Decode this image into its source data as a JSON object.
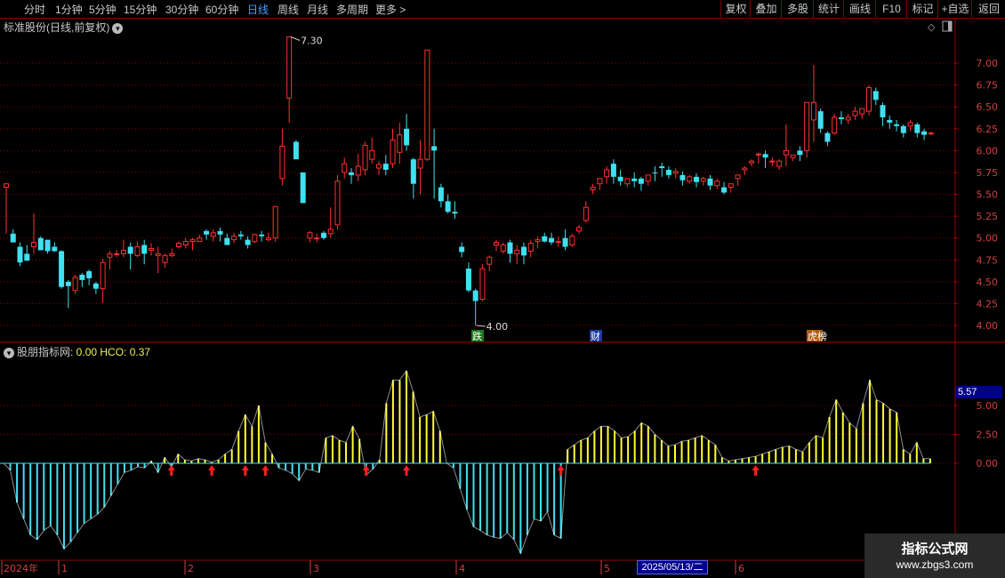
{
  "toolbar": {
    "periods": [
      "分时",
      "1分钟",
      "5分钟",
      "15分钟",
      "30分钟",
      "60分钟",
      "日线",
      "周线",
      "月线",
      "多周期",
      "更多 >"
    ],
    "right": [
      "复权",
      "叠加",
      "多股",
      "统计",
      "画线",
      "F10",
      "标记",
      "+自选",
      "返回"
    ]
  },
  "price_panel": {
    "title": "标准股份(日线,前复权)",
    "high_label": "7.30",
    "low_label": "4.00",
    "y_ticks": [
      "7.00",
      "6.75",
      "6.50",
      "6.25",
      "6.00",
      "5.75",
      "5.50",
      "5.25",
      "5.00",
      "4.75",
      "4.50",
      "4.25",
      "4.00"
    ],
    "badges": [
      {
        "text": "跌",
        "color": "#1a7a1a"
      },
      {
        "text": "财",
        "color": "#1a3aa0"
      },
      {
        "text": "龙虎榜",
        "color": "#b05a10"
      }
    ]
  },
  "indicator_panel": {
    "title": "股朋指标网",
    "value_label": ": 0.00",
    "hco_label": "HCO: 0.37",
    "y_ticks": [
      "5.00",
      "2.50",
      "0.00"
    ],
    "cursor_value": "5.57"
  },
  "date_axis": {
    "year_label": "2024年",
    "months": [
      "1",
      "2",
      "3",
      "4",
      "5",
      "6"
    ],
    "cursor_date": "2025/05/13/二"
  },
  "watermark": {
    "line1": "指标公式网",
    "line2": "www.zbgs3.com"
  },
  "colors": {
    "up": "#ff3030",
    "down": "#40e0f0",
    "ind_pos": "#ffff30",
    "ind_neg": "#40e0f0",
    "grid": "#8a0000"
  },
  "chart_data": {
    "type": "candlestick",
    "ylim": [
      3.95,
      7.35
    ],
    "candles": [
      [
        5.58,
        5.62,
        5.62,
        5.05
      ],
      [
        5.05,
        5.1,
        4.95,
        4.95
      ],
      [
        4.9,
        4.95,
        4.72,
        4.68
      ],
      [
        4.82,
        4.92,
        4.74,
        4.76
      ],
      [
        4.9,
        5.28,
        4.95,
        4.82
      ],
      [
        5.0,
        5.02,
        4.86,
        4.88
      ],
      [
        4.98,
        4.98,
        4.85,
        4.82
      ],
      [
        4.9,
        4.95,
        4.85,
        4.84
      ],
      [
        4.85,
        4.86,
        4.44,
        4.42
      ],
      [
        4.5,
        4.52,
        4.45,
        4.2
      ],
      [
        4.4,
        4.58,
        4.55,
        4.36
      ],
      [
        4.58,
        4.6,
        4.52,
        4.44
      ],
      [
        4.62,
        4.64,
        4.54,
        4.46
      ],
      [
        4.48,
        4.5,
        4.42,
        4.36
      ],
      [
        4.42,
        4.76,
        4.72,
        4.26
      ],
      [
        4.78,
        4.85,
        4.82,
        4.64
      ],
      [
        4.82,
        4.86,
        4.82,
        4.78
      ],
      [
        4.82,
        4.98,
        4.86,
        4.78
      ],
      [
        4.9,
        4.95,
        4.82,
        4.64
      ],
      [
        4.8,
        4.96,
        4.9,
        4.78
      ],
      [
        4.92,
        4.98,
        4.82,
        4.7
      ],
      [
        4.86,
        4.94,
        4.88,
        4.8
      ],
      [
        4.8,
        4.9,
        4.82,
        4.6
      ],
      [
        4.72,
        4.82,
        4.8,
        4.66
      ],
      [
        4.8,
        4.88,
        4.82,
        4.78
      ],
      [
        4.9,
        4.96,
        4.94,
        4.88
      ],
      [
        4.92,
        5.0,
        4.96,
        4.88
      ],
      [
        4.96,
        5.0,
        4.98,
        4.86
      ],
      [
        4.96,
        5.04,
        5.0,
        4.96
      ],
      [
        5.08,
        5.1,
        5.04,
        4.98
      ],
      [
        5.02,
        5.1,
        5.06,
        4.96
      ],
      [
        5.08,
        5.12,
        5.04,
        4.96
      ],
      [
        5.0,
        5.05,
        4.92,
        4.92
      ],
      [
        4.98,
        5.06,
        5.02,
        4.94
      ],
      [
        5.04,
        5.08,
        5.02,
        4.98
      ],
      [
        4.98,
        5.02,
        4.92,
        4.88
      ],
      [
        4.96,
        5.05,
        5.04,
        4.94
      ],
      [
        5.04,
        5.08,
        5.02,
        4.96
      ],
      [
        4.98,
        5.06,
        5.0,
        4.96
      ],
      [
        5.0,
        5.35,
        5.36,
        4.96
      ],
      [
        5.68,
        6.25,
        6.05,
        5.6
      ],
      [
        6.6,
        7.3,
        7.3,
        6.32
      ],
      [
        6.1,
        6.12,
        5.9,
        5.9
      ],
      [
        5.75,
        5.65,
        5.4,
        5.4
      ],
      [
        5.0,
        5.08,
        5.06,
        4.95
      ],
      [
        5.0,
        5.05,
        5.0,
        4.95
      ],
      [
        5.06,
        5.08,
        5.0,
        4.98
      ],
      [
        5.05,
        5.35,
        5.1,
        5.0
      ],
      [
        5.15,
        5.72,
        5.65,
        5.1
      ],
      [
        5.75,
        5.92,
        5.85,
        5.68
      ],
      [
        5.75,
        5.8,
        5.72,
        5.62
      ],
      [
        5.72,
        5.96,
        5.82,
        5.65
      ],
      [
        5.78,
        6.1,
        6.06,
        5.72
      ],
      [
        5.9,
        6.15,
        6.0,
        5.85
      ],
      [
        5.8,
        5.88,
        5.84,
        5.72
      ],
      [
        5.85,
        5.95,
        5.78,
        5.72
      ],
      [
        5.85,
        6.25,
        6.12,
        5.8
      ],
      [
        5.98,
        6.32,
        6.18,
        5.85
      ],
      [
        6.25,
        6.42,
        6.06,
        6.0
      ],
      [
        5.9,
        5.92,
        5.62,
        5.45
      ],
      [
        5.8,
        6.12,
        5.9,
        5.5
      ],
      [
        5.9,
        7.15,
        7.15,
        5.88
      ],
      [
        6.05,
        6.25,
        6.0,
        5.45
      ],
      [
        5.58,
        5.62,
        5.42,
        5.35
      ],
      [
        5.42,
        5.5,
        5.3,
        5.28
      ],
      [
        5.3,
        5.42,
        5.28,
        5.22
      ],
      [
        4.9,
        4.95,
        4.84,
        4.78
      ],
      [
        4.65,
        4.72,
        4.4,
        4.38
      ],
      [
        4.4,
        4.42,
        4.28,
        4.0
      ],
      [
        4.3,
        4.7,
        4.65,
        4.28
      ],
      [
        4.7,
        4.8,
        4.78,
        4.62
      ],
      [
        4.92,
        4.98,
        4.95,
        4.85
      ],
      [
        4.85,
        4.95,
        4.92,
        4.82
      ],
      [
        4.95,
        4.98,
        4.82,
        4.72
      ],
      [
        4.82,
        4.92,
        4.86,
        4.7
      ],
      [
        4.9,
        4.95,
        4.8,
        4.7
      ],
      [
        4.85,
        4.98,
        4.94,
        4.78
      ],
      [
        4.96,
        5.02,
        4.98,
        4.88
      ],
      [
        5.02,
        5.06,
        4.96,
        4.95
      ],
      [
        5.0,
        5.06,
        4.95,
        4.92
      ],
      [
        4.95,
        5.02,
        4.96,
        4.9
      ],
      [
        5.0,
        5.1,
        4.9,
        4.86
      ],
      [
        4.92,
        5.05,
        5.02,
        4.9
      ],
      [
        5.08,
        5.15,
        5.12,
        5.05
      ],
      [
        5.2,
        5.42,
        5.35,
        5.18
      ],
      [
        5.55,
        5.62,
        5.58,
        5.5
      ],
      [
        5.62,
        5.65,
        5.68,
        5.55
      ],
      [
        5.7,
        5.82,
        5.78,
        5.62
      ],
      [
        5.85,
        5.9,
        5.7,
        5.62
      ],
      [
        5.7,
        5.78,
        5.65,
        5.6
      ],
      [
        5.62,
        5.68,
        5.68,
        5.58
      ],
      [
        5.68,
        5.75,
        5.65,
        5.58
      ],
      [
        5.68,
        5.7,
        5.62,
        5.54
      ],
      [
        5.65,
        5.72,
        5.72,
        5.6
      ],
      [
        5.75,
        5.82,
        5.74,
        5.65
      ],
      [
        5.82,
        5.86,
        5.8,
        5.7
      ],
      [
        5.78,
        5.82,
        5.72,
        5.68
      ],
      [
        5.74,
        5.8,
        5.76,
        5.68
      ],
      [
        5.72,
        5.76,
        5.66,
        5.6
      ],
      [
        5.65,
        5.72,
        5.7,
        5.62
      ],
      [
        5.7,
        5.74,
        5.64,
        5.58
      ],
      [
        5.65,
        5.7,
        5.68,
        5.6
      ],
      [
        5.68,
        5.72,
        5.6,
        5.55
      ],
      [
        5.6,
        5.68,
        5.65,
        5.56
      ],
      [
        5.58,
        5.64,
        5.52,
        5.5
      ],
      [
        5.58,
        5.62,
        5.62,
        5.52
      ],
      [
        5.68,
        5.72,
        5.72,
        5.6
      ],
      [
        5.78,
        5.82,
        5.8,
        5.72
      ],
      [
        5.86,
        5.9,
        5.88,
        5.82
      ],
      [
        5.95,
        5.98,
        5.96,
        5.85
      ],
      [
        5.96,
        6.0,
        5.92,
        5.8
      ],
      [
        5.88,
        5.92,
        5.88,
        5.82
      ],
      [
        5.82,
        5.9,
        5.88,
        5.78
      ],
      [
        5.95,
        6.3,
        6.0,
        5.82
      ],
      [
        5.92,
        5.95,
        5.95,
        5.88
      ],
      [
        6.0,
        6.05,
        5.95,
        5.88
      ],
      [
        6.0,
        6.55,
        6.55,
        5.92
      ],
      [
        6.35,
        6.98,
        6.55,
        6.1
      ],
      [
        6.45,
        6.48,
        6.25,
        6.2
      ],
      [
        6.2,
        6.22,
        6.1,
        6.05
      ],
      [
        6.2,
        6.42,
        6.38,
        6.18
      ],
      [
        6.38,
        6.45,
        6.36,
        6.3
      ],
      [
        6.35,
        6.42,
        6.38,
        6.3
      ],
      [
        6.4,
        6.5,
        6.45,
        6.35
      ],
      [
        6.42,
        6.48,
        6.48,
        6.36
      ],
      [
        6.45,
        6.75,
        6.72,
        6.4
      ],
      [
        6.68,
        6.72,
        6.58,
        6.52
      ],
      [
        6.52,
        6.55,
        6.38,
        6.28
      ],
      [
        6.35,
        6.4,
        6.32,
        6.25
      ],
      [
        6.3,
        6.35,
        6.28,
        6.22
      ],
      [
        6.28,
        6.3,
        6.2,
        6.15
      ],
      [
        6.28,
        6.35,
        6.32,
        6.22
      ],
      [
        6.3,
        6.32,
        6.2,
        6.15
      ],
      [
        6.22,
        6.25,
        6.18,
        6.12
      ],
      [
        6.2,
        6.22,
        6.2,
        6.18
      ]
    ],
    "indicator": {
      "ylim": [
        -8.2,
        9.2
      ],
      "values": [
        0,
        -0.6,
        -3.4,
        -4.8,
        -6.2,
        -6.6,
        -5.8,
        -5.4,
        -6.2,
        -7.4,
        -6.8,
        -6.0,
        -5.2,
        -4.8,
        -4.4,
        -3.8,
        -2.8,
        -1.8,
        -0.8,
        -0.6,
        -0.3,
        -0.4,
        0.2,
        -0.8,
        0.5,
        -0.3,
        0.8,
        0.3,
        0.2,
        0.4,
        0.3,
        0.1,
        0.3,
        0.8,
        1.2,
        2.8,
        4.2,
        3.2,
        5.0,
        1.8,
        0.8,
        -0.4,
        -0.6,
        -0.9,
        -1.5,
        -0.5,
        -0.6,
        -0.8,
        2.2,
        2.4,
        2.0,
        1.8,
        3.2,
        2.1,
        -1.0,
        -0.5,
        0.3,
        5.2,
        7.2,
        7.2,
        8.0,
        6.2,
        4.0,
        4.2,
        4.5,
        2.8,
        0,
        -0.4,
        -2.2,
        -4.0,
        -5.5,
        -5.8,
        -6.2,
        -6.4,
        -6.5,
        -6.0,
        -6.6,
        -7.8,
        -6.2,
        -4.8,
        -5.0,
        -4.2,
        -6.2,
        -6.5,
        1.2,
        1.6,
        2.0,
        2.2,
        2.8,
        3.2,
        3.2,
        2.8,
        2.2,
        2.3,
        2.8,
        3.5,
        3.2,
        2.5,
        2.0,
        1.5,
        1.6,
        1.9,
        2.0,
        2.2,
        2.4,
        2.0,
        1.6,
        0.5,
        0.2,
        0.3,
        0.4,
        0.5,
        0.6,
        0.8,
        1.0,
        1.2,
        1.4,
        1.5,
        1.2,
        1.0,
        1.8,
        2.4,
        2.2,
        4.0,
        5.5,
        4.4,
        3.5,
        3.0,
        5.2,
        7.2,
        5.5,
        5.2,
        4.7,
        4.4,
        1.2,
        0.8,
        1.8,
        0.4,
        0.4
      ],
      "arrows": [
        25,
        31,
        36,
        39,
        54,
        60,
        83,
        112
      ]
    }
  }
}
